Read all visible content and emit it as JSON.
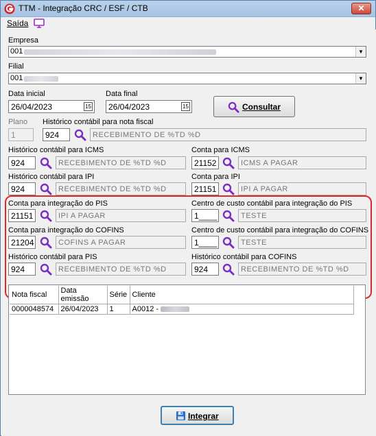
{
  "window": {
    "title": "TTM - Integração CRC / ESF / CTB",
    "close_label": "✕"
  },
  "menu": {
    "saida_label": "Saída"
  },
  "empresa": {
    "label": "Empresa",
    "value": "001"
  },
  "filial": {
    "label": "Filial",
    "value": "001"
  },
  "data_inicial": {
    "label": "Data inicial",
    "value": "26/04/2023"
  },
  "data_final": {
    "label": "Data final",
    "value": "26/04/2023"
  },
  "consultar_button": {
    "label": "Consultar"
  },
  "plano": {
    "label": "Plano",
    "value": "1"
  },
  "historico_nota_fiscal": {
    "label": "Histórico contábil para nota fiscal",
    "code": "924",
    "desc": "RECEBIMENTO DE %TD %D"
  },
  "historico_icms": {
    "label": "Histórico contábil para ICMS",
    "code": "924",
    "desc": "RECEBIMENTO DE %TD %D"
  },
  "conta_icms": {
    "label": "Conta para ICMS",
    "code": "21152",
    "desc": "ICMS A PAGAR"
  },
  "historico_ipi": {
    "label": "Histórico contábil para IPI",
    "code": "924",
    "desc": "RECEBIMENTO DE %TD %D"
  },
  "conta_ipi": {
    "label": "Conta para IPI",
    "code": "21151",
    "desc": "IPI A PAGAR"
  },
  "conta_pis": {
    "label": "Conta para integração do PIS",
    "code": "21151",
    "desc": "IPI A PAGAR"
  },
  "centro_custo_pis": {
    "label": "Centro de custo contábil para integração do PIS",
    "code": "1____",
    "desc": "TESTE"
  },
  "conta_cofins": {
    "label": "Conta para integração do COFINS",
    "code": "21204",
    "desc": "COFINS A PAGAR"
  },
  "centro_custo_cofins": {
    "label": "Centro de custo contábil para integração do COFINS",
    "code": "1____",
    "desc": "TESTE"
  },
  "historico_pis": {
    "label": "Histórico contábil para PIS",
    "code": "924",
    "desc": "RECEBIMENTO DE %TD %D"
  },
  "historico_cofins": {
    "label": "Histórico contábil para COFINS",
    "code": "924",
    "desc": "RECEBIMENTO DE %TD %D"
  },
  "grid": {
    "columns": [
      "Nota fiscal",
      "Data emissão",
      "Série",
      "Cliente"
    ],
    "rows": [
      {
        "nota_fiscal": "0000048574",
        "data_emissao": "26/04/2023",
        "serie": "1",
        "cliente": "A0012 -"
      }
    ]
  },
  "integrar_button": {
    "label": "Integrar"
  },
  "colors": {
    "highlight": "#e02828",
    "search_icon": "#7b2fbf"
  }
}
